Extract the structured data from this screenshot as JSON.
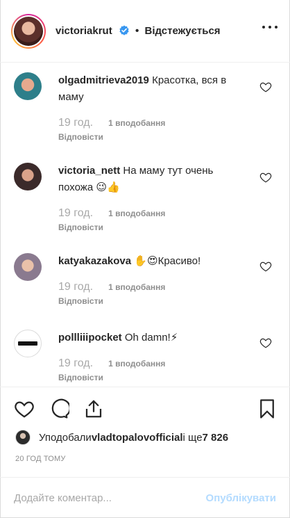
{
  "header": {
    "username": "victoriakrut",
    "separator": "•",
    "follow_label": "Відстежується"
  },
  "comments": [
    {
      "username": "olgadmitrieva2019",
      "text": "Красотка, вся в маму",
      "time": "19 год.",
      "likes": "1 вподобання",
      "reply": "Відповісти",
      "avatar_color": "#2e7f8a"
    },
    {
      "username": "victoria_nett",
      "text": "На маму тут очень похожа 😉👍",
      "time": "19 год.",
      "likes": "1 вподобання",
      "reply": "Відповісти",
      "avatar_color": "#3b2a2a"
    },
    {
      "username": "katyakazakova",
      "text": "✋😍Красиво!",
      "time": "19 год.",
      "likes": "1 вподобання",
      "reply": "Відповісти",
      "avatar_color": "#8a7a8f"
    },
    {
      "username": "pollliiipocket",
      "text": "Oh damn!⚡",
      "time": "19 год.",
      "likes": "1 вподобання",
      "reply": "Відповісти",
      "avatar_color": "#ffffff"
    }
  ],
  "likes": {
    "prefix": "Уподобали ",
    "user": "vladtopalovofficial",
    "middle": " і ще ",
    "count": "7 826"
  },
  "posted": "20 ГОД ТОМУ",
  "add_comment": {
    "placeholder": "Додайте коментар...",
    "publish_label": "Опублікувати"
  },
  "colors": {
    "text": "#262626",
    "secondary": "#8e8e8e",
    "verified": "#3897f0",
    "publish_disabled": "#b3dbff"
  }
}
